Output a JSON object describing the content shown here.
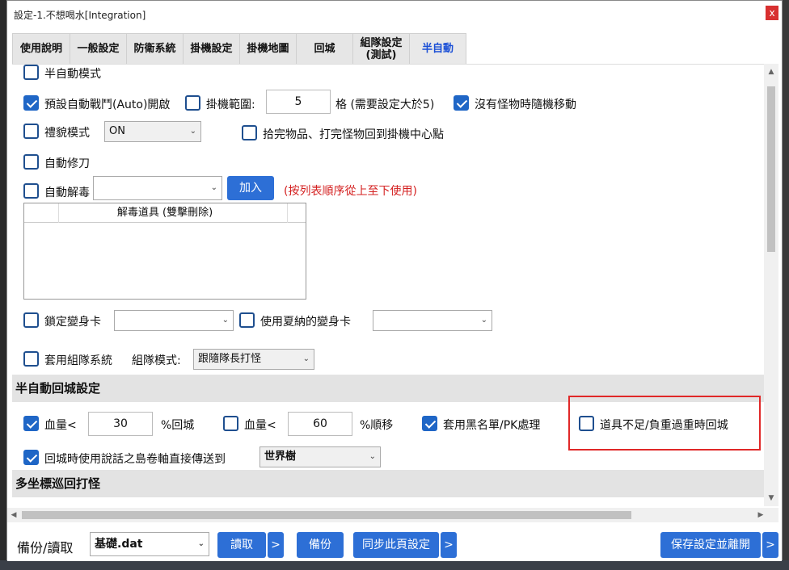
{
  "window": {
    "title": "設定-1.不想喝水[Integration]",
    "close_label": "x"
  },
  "tabs": [
    {
      "label": "使用說明"
    },
    {
      "label": "一般設定"
    },
    {
      "label": "防衛系統"
    },
    {
      "label": "掛機設定"
    },
    {
      "label": "掛機地圖"
    },
    {
      "label": "回城"
    },
    {
      "label": "組隊設定\n(測試)"
    },
    {
      "label": "半自動",
      "active": true
    }
  ],
  "semi_auto": {
    "semi_auto_mode": {
      "label": "半自動模式",
      "checked": false
    },
    "default_auto_battle": {
      "label": "預設自動戰鬥(Auto)開啟",
      "checked": true
    },
    "hang_range": {
      "label": "掛機範圍:",
      "checked": false,
      "value": "5",
      "suffix": "格 (需要設定大於5)"
    },
    "random_move": {
      "label": "沒有怪物時隨機移動",
      "checked": true
    },
    "polite_mode": {
      "label": "禮貌模式",
      "checked": false,
      "select_value": "ON"
    },
    "return_center": {
      "label": "拾完物品、打完怪物回到掛機中心點",
      "checked": false
    },
    "auto_repair": {
      "label": "自動修刀",
      "checked": false
    },
    "auto_detox": {
      "label": "自動解毒",
      "checked": false,
      "select_value": "",
      "add_button": "加入",
      "hint": "(按列表順序從上至下使用)"
    },
    "detox_list": {
      "header": "解毒道具 (雙擊刪除)"
    },
    "lock_morph": {
      "label": "鎖定變身卡",
      "checked": false,
      "select_value": ""
    },
    "use_summer_morph": {
      "label": "使用夏納的變身卡",
      "checked": false,
      "select_value": ""
    },
    "party_system": {
      "label": "套用組隊系統",
      "checked": false,
      "mode_label": "組隊模式:",
      "mode_value": "跟隨隊長打怪"
    }
  },
  "return_settings": {
    "header": "半自動回城設定",
    "hp1": {
      "label": "血量<",
      "checked": true,
      "value": "30",
      "suffix": "%回城"
    },
    "hp2": {
      "label": "血量<",
      "checked": false,
      "value": "60",
      "suffix": "%順移"
    },
    "blacklist": {
      "label": "套用黑名單/PK處理",
      "checked": true
    },
    "item_shortage": {
      "label": "道具不足/負重過重時回城",
      "checked": false
    },
    "talking_scroll": {
      "label": "回城時使用說話之島卷軸直接傳送到",
      "checked": true,
      "select_value": "世界樹"
    }
  },
  "patrol": {
    "header": "多坐標巡回打怪"
  },
  "footer": {
    "backup_label": "備份/讀取",
    "file_value": "基礎.dat",
    "read_button": "讀取",
    "more1": ">",
    "backup_button": "備份",
    "sync_button": "同步此頁設定",
    "more2": ">",
    "save_exit_button": "保存設定並離開",
    "more3": ">"
  },
  "colors": {
    "accent": "#2d6fd6",
    "checkbox": "#1f66c6",
    "highlight": "#e02828",
    "hint": "#d42020"
  }
}
